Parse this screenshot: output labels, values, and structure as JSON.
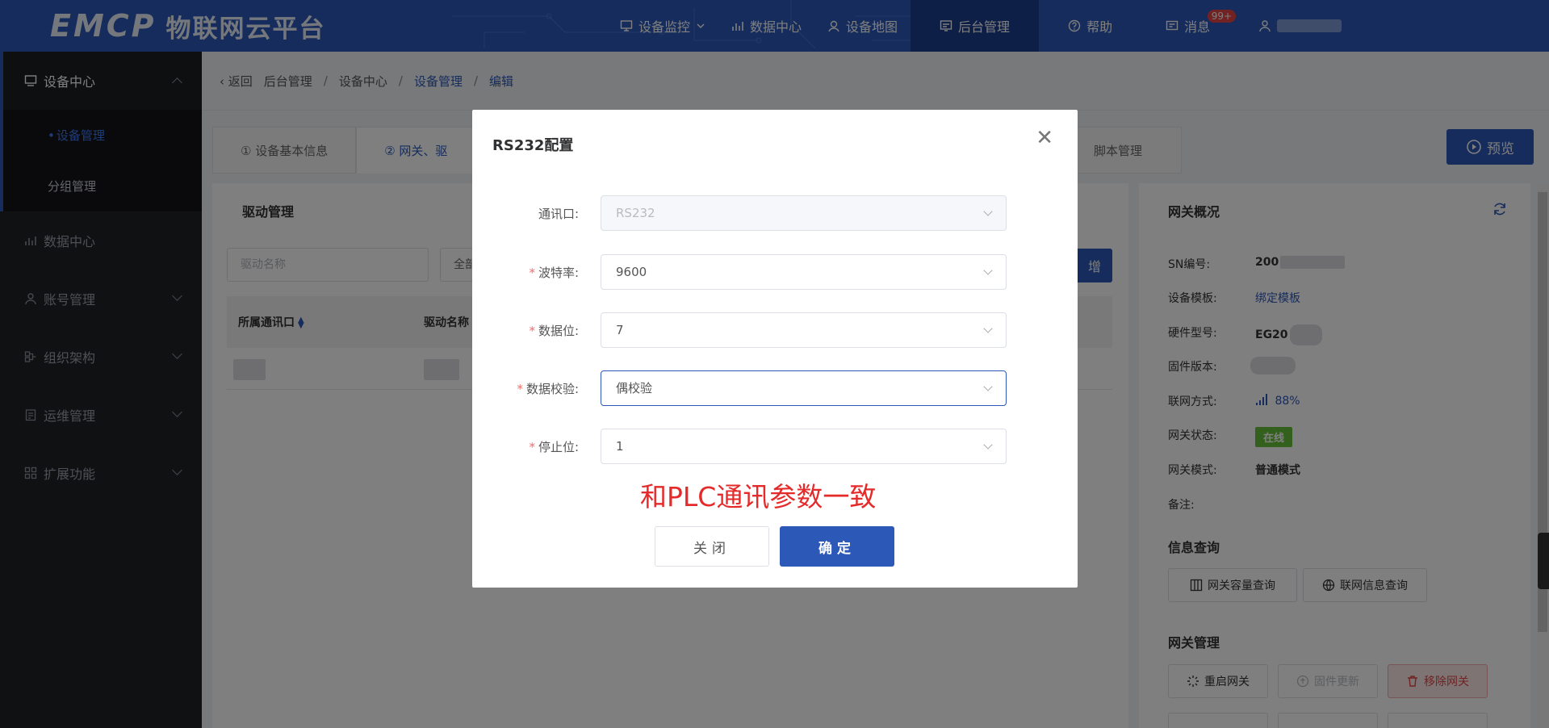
{
  "header": {
    "brand": "EMCP",
    "brand_cn": "物联网云平台",
    "nav": [
      {
        "label": "设备监控",
        "icon": "monitor-icon",
        "dropdown": true
      },
      {
        "label": "数据中心",
        "icon": "chart-icon"
      },
      {
        "label": "设备地图",
        "icon": "map-pin-icon"
      },
      {
        "label": "后台管理",
        "icon": "admin-icon",
        "active": true
      },
      {
        "label": "帮助",
        "icon": "help-icon"
      },
      {
        "label": "消息",
        "icon": "message-icon",
        "badge": "99+"
      }
    ]
  },
  "sidebar": {
    "groups": [
      {
        "label": "设备中心",
        "open": true,
        "items": [
          {
            "label": "设备管理",
            "active": true
          },
          {
            "label": "分组管理"
          }
        ]
      },
      {
        "label": "数据中心"
      },
      {
        "label": "账号管理"
      },
      {
        "label": "组织架构"
      },
      {
        "label": "运维管理"
      },
      {
        "label": "扩展功能"
      }
    ]
  },
  "breadcrumb": {
    "back": "返回",
    "items": [
      "后台管理",
      "设备中心",
      "设备管理",
      "编辑"
    ]
  },
  "tabs": {
    "tab1": "① 设备基本信息",
    "tab2": "② 网关、驱",
    "tab_script": "脚本管理",
    "preview": "预览"
  },
  "driver_panel": {
    "title": "驱动管理",
    "search_placeholder": "驱动名称",
    "filter_value": "全部",
    "add_label": "增",
    "columns": [
      "所属通讯口",
      "驱动名称"
    ]
  },
  "gateway_panel": {
    "title": "网关概况",
    "sn_label": "SN编号:",
    "sn_value": "200",
    "template_label": "设备模板:",
    "template_value": "绑定模板",
    "hw_label": "硬件型号:",
    "hw_value": "EG20",
    "fw_label": "固件版本:",
    "net_label": "联网方式:",
    "net_value": "88%",
    "status_label": "网关状态:",
    "status_value": "在线",
    "mode_label": "网关模式:",
    "mode_value": "普通模式",
    "note_label": "备注:",
    "info_title": "信息查询",
    "btn_capacity": "网关容量查询",
    "btn_network": "联网信息查询",
    "manage_title": "网关管理",
    "btn_restart": "重启网关",
    "btn_firmware": "固件更新",
    "btn_remove": "移除网关"
  },
  "modal": {
    "title": "RS232配置",
    "fields": [
      {
        "label": "通讯口:",
        "value": "RS232",
        "required": false,
        "disabled": true
      },
      {
        "label": "波特率:",
        "value": "9600",
        "required": true
      },
      {
        "label": "数据位:",
        "value": "7",
        "required": true
      },
      {
        "label": "数据校验:",
        "value": "偶校验",
        "required": true,
        "focus": true
      },
      {
        "label": "停止位:",
        "value": "1",
        "required": true
      }
    ],
    "annotation": "和PLC通讯参数一致",
    "btn_close": "关闭",
    "btn_ok": "确定"
  },
  "colors": {
    "primary": "#2c58b8",
    "sidebar_bg": "#202227",
    "annotation": "#e52a2a",
    "online": "#67c23a",
    "danger": "#e54545"
  }
}
